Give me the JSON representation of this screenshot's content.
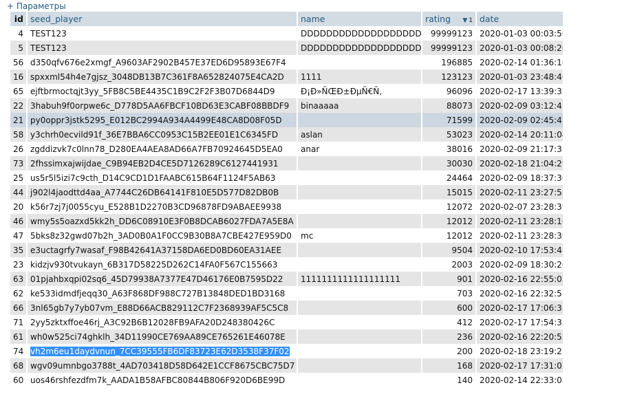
{
  "params_link": "+ Параметры",
  "columns": {
    "id": "id",
    "seed_player": "seed_player",
    "name": "name",
    "rating": "rating",
    "rating_sort_index": "1",
    "date": "date"
  },
  "colors": {
    "header_bg": "#d3dce3",
    "row_even": "#e5e5e5",
    "row_highlight": "#ccd7e2",
    "link": "#235a81",
    "selection": "#3390ff"
  },
  "rows": [
    {
      "id": "4",
      "seed": "TEST123",
      "name": "DDDDDDDDDDDDDDDDDDD",
      "rating": "99999123",
      "date": "2020-01-03 00:03:50"
    },
    {
      "id": "5",
      "seed": "TEST123",
      "name": "DDDDDDDDDDDDDDDDDDD",
      "rating": "99999123",
      "date": "2020-01-03 00:08:20"
    },
    {
      "id": "56",
      "seed": "d350qfv676e2xmgf_A9603AF2902B457E37ED6D95893E67F4",
      "name": "",
      "rating": "196885",
      "date": "2020-02-14 01:36:10"
    },
    {
      "id": "16",
      "seed": "spxxml54h4e7gjsz_3048DB13B7C361F8A652824075E4CA2D",
      "name": "1111",
      "rating": "123123",
      "date": "2020-01-03 23:48:46"
    },
    {
      "id": "65",
      "seed": "ejftbrmoctqjt3yy_5FB8C5BE4435C1B9C2F2F3B07D6844D9",
      "name": "Ð¡Ð»ÑŒÐ±ÐµÑ€Ñ‚",
      "rating": "96096",
      "date": "2020-02-17 13:39:32"
    },
    {
      "id": "22",
      "seed": "3habuh9f0orpwe6c_D778D5AA6FBCF10BD63E3CABF08BBDF9",
      "name": "binaaaaa",
      "rating": "88073",
      "date": "2020-02-09 03:12:41"
    },
    {
      "id": "21",
      "seed": "py0oppr3jstk5295_E012BC2994A934A4499E48CA8D08F05D",
      "name": "",
      "rating": "71599",
      "date": "2020-02-09 02:45:47"
    },
    {
      "id": "58",
      "seed": "y3chrh0ecvild91f_36E7BBA6CC0953C15B2EE01E1C6345FD",
      "name": "aslan",
      "rating": "53023",
      "date": "2020-02-14 20:11:04"
    },
    {
      "id": "26",
      "seed": "zgddizvk7c0lnn78_D280EA4AEA8AD66A7FB70924645D5EA0",
      "name": "anar",
      "rating": "38016",
      "date": "2020-02-09 21:17:31"
    },
    {
      "id": "73",
      "seed": "2fhssimxajwijdae_C9B94EB2D4CE5D7126289C6127441931",
      "name": "",
      "rating": "30030",
      "date": "2020-02-18 21:04:29"
    },
    {
      "id": "25",
      "seed": "us5r5l5izi7c9cth_D14C9CD1D1FAABC615B64F1124F5AB63",
      "name": "",
      "rating": "24464",
      "date": "2020-02-09 18:37:30"
    },
    {
      "id": "44",
      "seed": "j902l4jaodttd4aa_A7744C26DB64141F810E5D577D82DB0B",
      "name": "",
      "rating": "15015",
      "date": "2020-02-11 23:27:53"
    },
    {
      "id": "20",
      "seed": "k56r7zj7j0055cyu_E528B1D2270B3CD96878FD9ABAEE9938",
      "name": "",
      "rating": "12072",
      "date": "2020-02-07 23:28:39"
    },
    {
      "id": "46",
      "seed": "wmy5s5oazxd5kk2h_DD6C08910E3F0B8DCAB6027FDA7A5E8A",
      "name": "",
      "rating": "12012",
      "date": "2020-02-11 23:28:10"
    },
    {
      "id": "47",
      "seed": "5bks8z32gwd07b2h_3AD0B0A1F0CC9B30B8A7CBE427E959D0",
      "name": "mc",
      "rating": "12012",
      "date": "2020-02-11 23:28:39"
    },
    {
      "id": "35",
      "seed": "e3uctagrfy7wasaf_F98B42641A37158DA6ED0BD60EA31AEE",
      "name": "",
      "rating": "9504",
      "date": "2020-02-10 17:53:48"
    },
    {
      "id": "23",
      "seed": "kidzjv930tvukayn_6B317D58225D262C14FA0F567C155663",
      "name": "",
      "rating": "2003",
      "date": "2020-02-09 18:30:20"
    },
    {
      "id": "63",
      "seed": "01pjahbxqpi02sq6_45D79938A7377E47D46176E0B7595D22",
      "name": "1111111111111111111",
      "rating": "901",
      "date": "2020-02-16 22:55:05"
    },
    {
      "id": "62",
      "seed": "ke533idmdfjeqq30_A63F868DF988C727B13848DED1BD3168",
      "name": "",
      "rating": "703",
      "date": "2020-02-16 22:32:57"
    },
    {
      "id": "66",
      "seed": "3nl65gb7y7yb07vm_E88D66ACB829112C7F2368939AF5C5C8",
      "name": "",
      "rating": "600",
      "date": "2020-02-17 17:06:35"
    },
    {
      "id": "71",
      "seed": "2yy5zktxffoe46rj_A3C92B6B12028FB9AFA20D248380426C",
      "name": "",
      "rating": "412",
      "date": "2020-02-17 17:54:32"
    },
    {
      "id": "61",
      "seed": "wh0w525ci74ghklh_34D11990CE769AA89CE765261E46078E",
      "name": "",
      "rating": "236",
      "date": "2020-02-16 22:20:52"
    },
    {
      "id": "74",
      "seed": "vh2m6eu1daydvnun_7CC39555FB6DF83723E62D3538F37F02",
      "name": "",
      "rating": "200",
      "date": "2020-02-18 23:19:22"
    },
    {
      "id": "68",
      "seed": "wgv09umnbgo3788t_4AD703418D58D642E1CCF8675CBC75D7",
      "name": "",
      "rating": "168",
      "date": "2020-02-17 17:31:02"
    },
    {
      "id": "60",
      "seed": "uos46rshfezdfm7k_AADA1B58AFBC80844B806F920D6BE99D",
      "name": "",
      "rating": "140",
      "date": "2020-02-14 22:33:08"
    }
  ]
}
